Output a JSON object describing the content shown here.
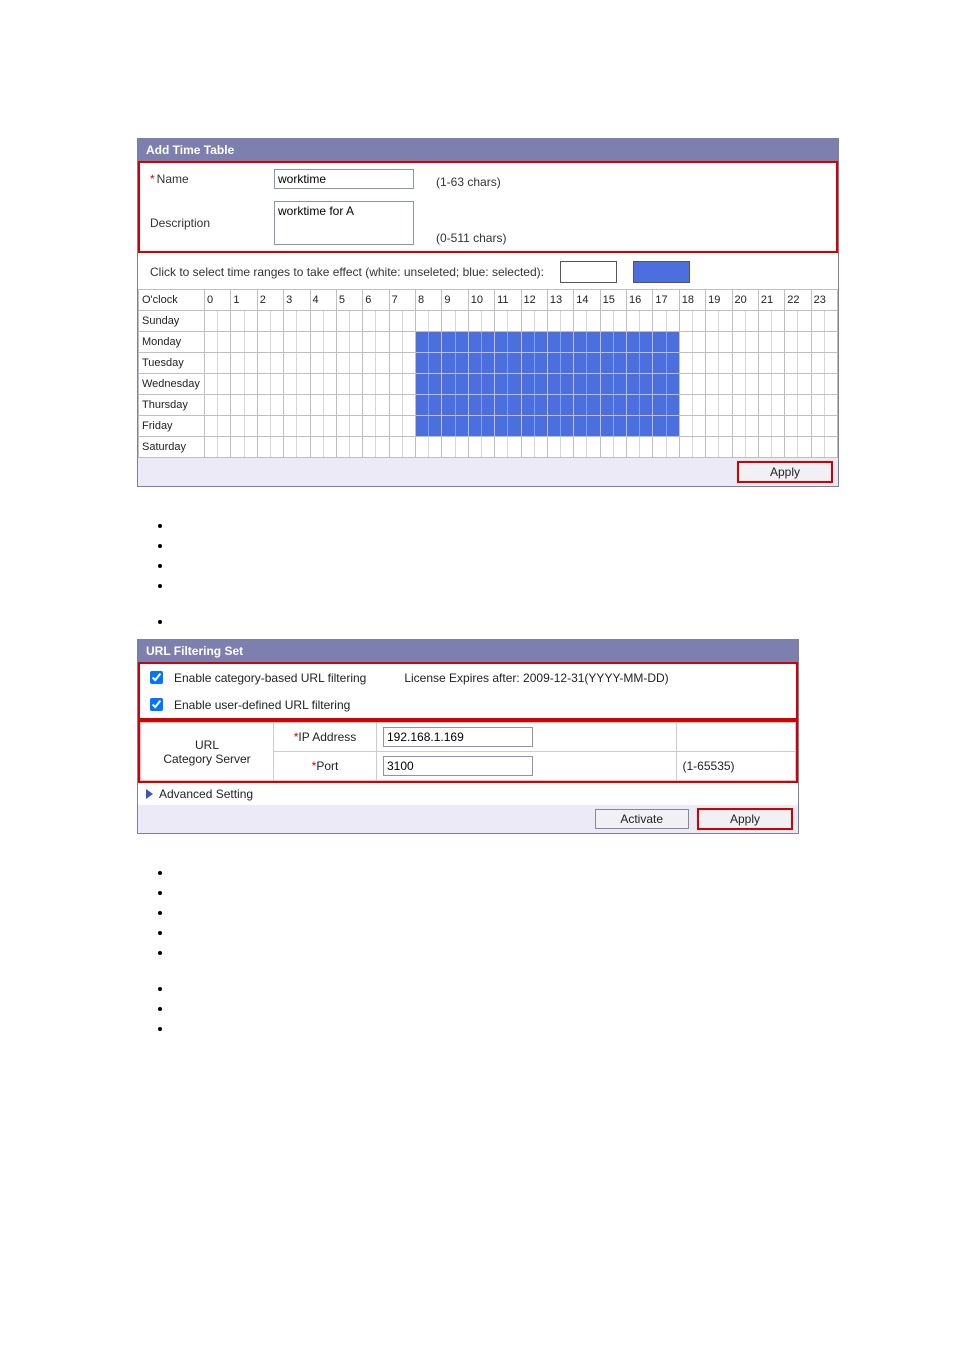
{
  "time_table": {
    "header": "Add Time Table",
    "name": {
      "label": "Name",
      "required": true,
      "value": "worktime",
      "hint": "(1-63 chars)"
    },
    "description": {
      "label": "Description",
      "required": false,
      "value": "worktime for A",
      "hint": "(0-511 chars)"
    },
    "select_note": "Click to select time ranges to take effect (white: unseleted; blue: selected):",
    "hours_header": "O'clock",
    "hours": [
      "0",
      "1",
      "2",
      "3",
      "4",
      "5",
      "6",
      "7",
      "8",
      "9",
      "10",
      "11",
      "12",
      "13",
      "14",
      "15",
      "16",
      "17",
      "18",
      "19",
      "20",
      "21",
      "22",
      "23"
    ],
    "days": [
      "Sunday",
      "Monday",
      "Tuesday",
      "Wednesday",
      "Thursday",
      "Friday",
      "Saturday"
    ],
    "selected": {
      "days": [
        "Monday",
        "Tuesday",
        "Wednesday",
        "Thursday",
        "Friday"
      ],
      "hour_start": 8,
      "hour_end_exclusive": 18
    },
    "apply_label": "Apply"
  },
  "url_filter": {
    "header": "URL Filtering Set",
    "enable_cat": {
      "label": "Enable category-based URL filtering",
      "checked": true
    },
    "license": "License Expires after: 2009-12-31(YYYY-MM-DD)",
    "enable_user": {
      "label": "Enable user-defined URL filtering",
      "checked": true
    },
    "server_section_label": "URL\nCategory Server",
    "ip": {
      "label": "IP Address",
      "required": true,
      "value": "192.168.1.169"
    },
    "port": {
      "label": "Port",
      "required": true,
      "value": "3100",
      "hint": "(1-65535)"
    },
    "advanced_label": "Advanced Setting",
    "activate_label": "Activate",
    "apply_label": "Apply"
  }
}
